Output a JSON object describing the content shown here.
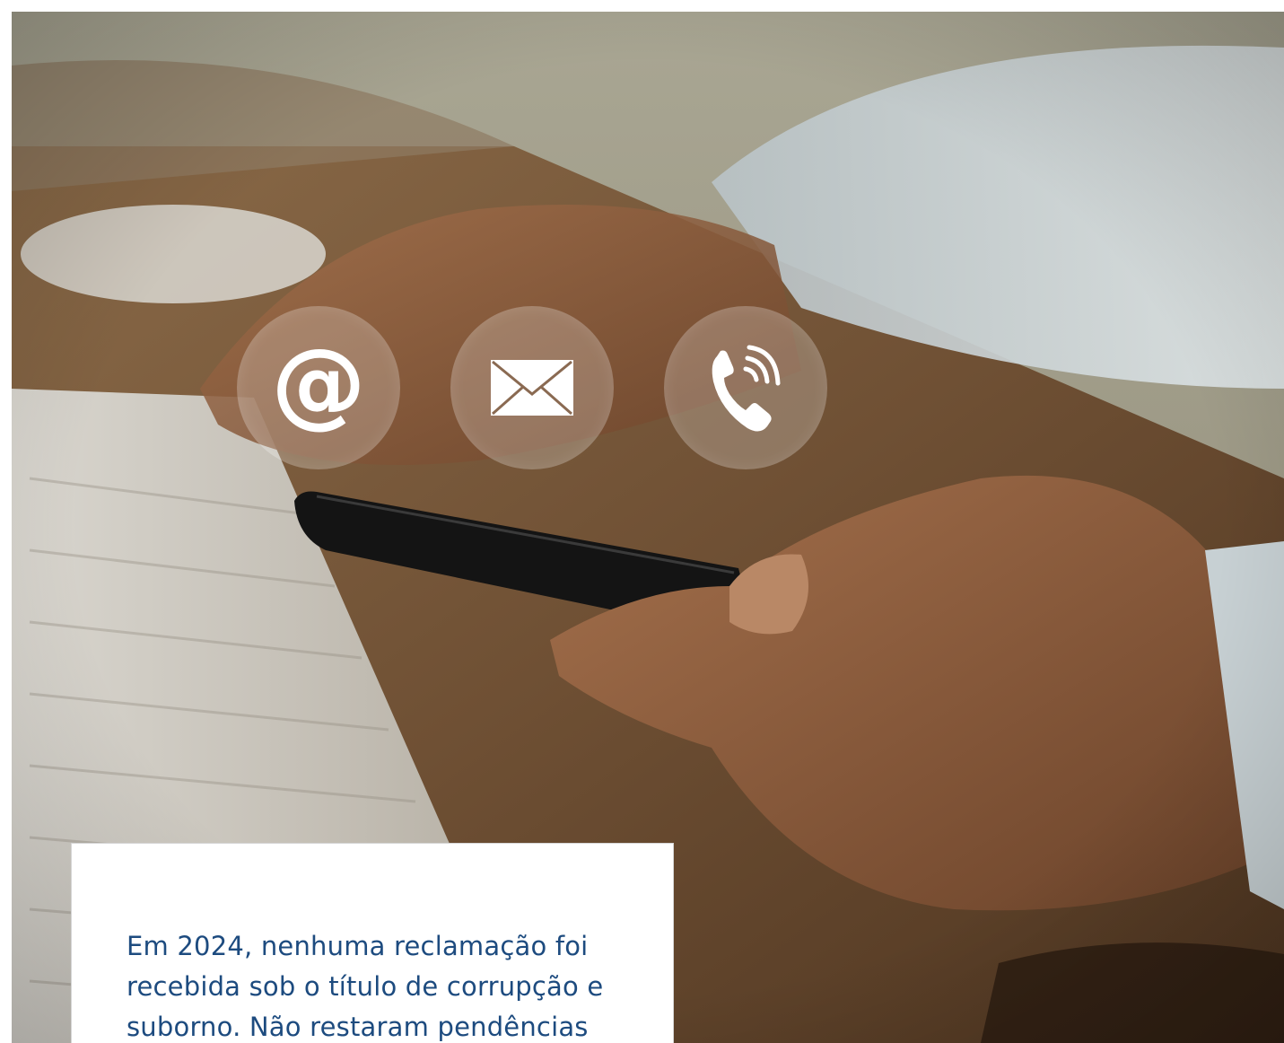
{
  "photo": {
    "icons": [
      {
        "name": "at-sign-icon",
        "glyph": "@"
      },
      {
        "name": "envelope-icon"
      },
      {
        "name": "phone-call-icon"
      }
    ],
    "icon_color": "#ffffff"
  },
  "textbox": {
    "lines": [
      "Em 2024, nenhuma reclamação foi",
      "recebida sob o título de corrupção e",
      "suborno. Não restaram pendências"
    ],
    "text_color": "#1d4b7f"
  }
}
